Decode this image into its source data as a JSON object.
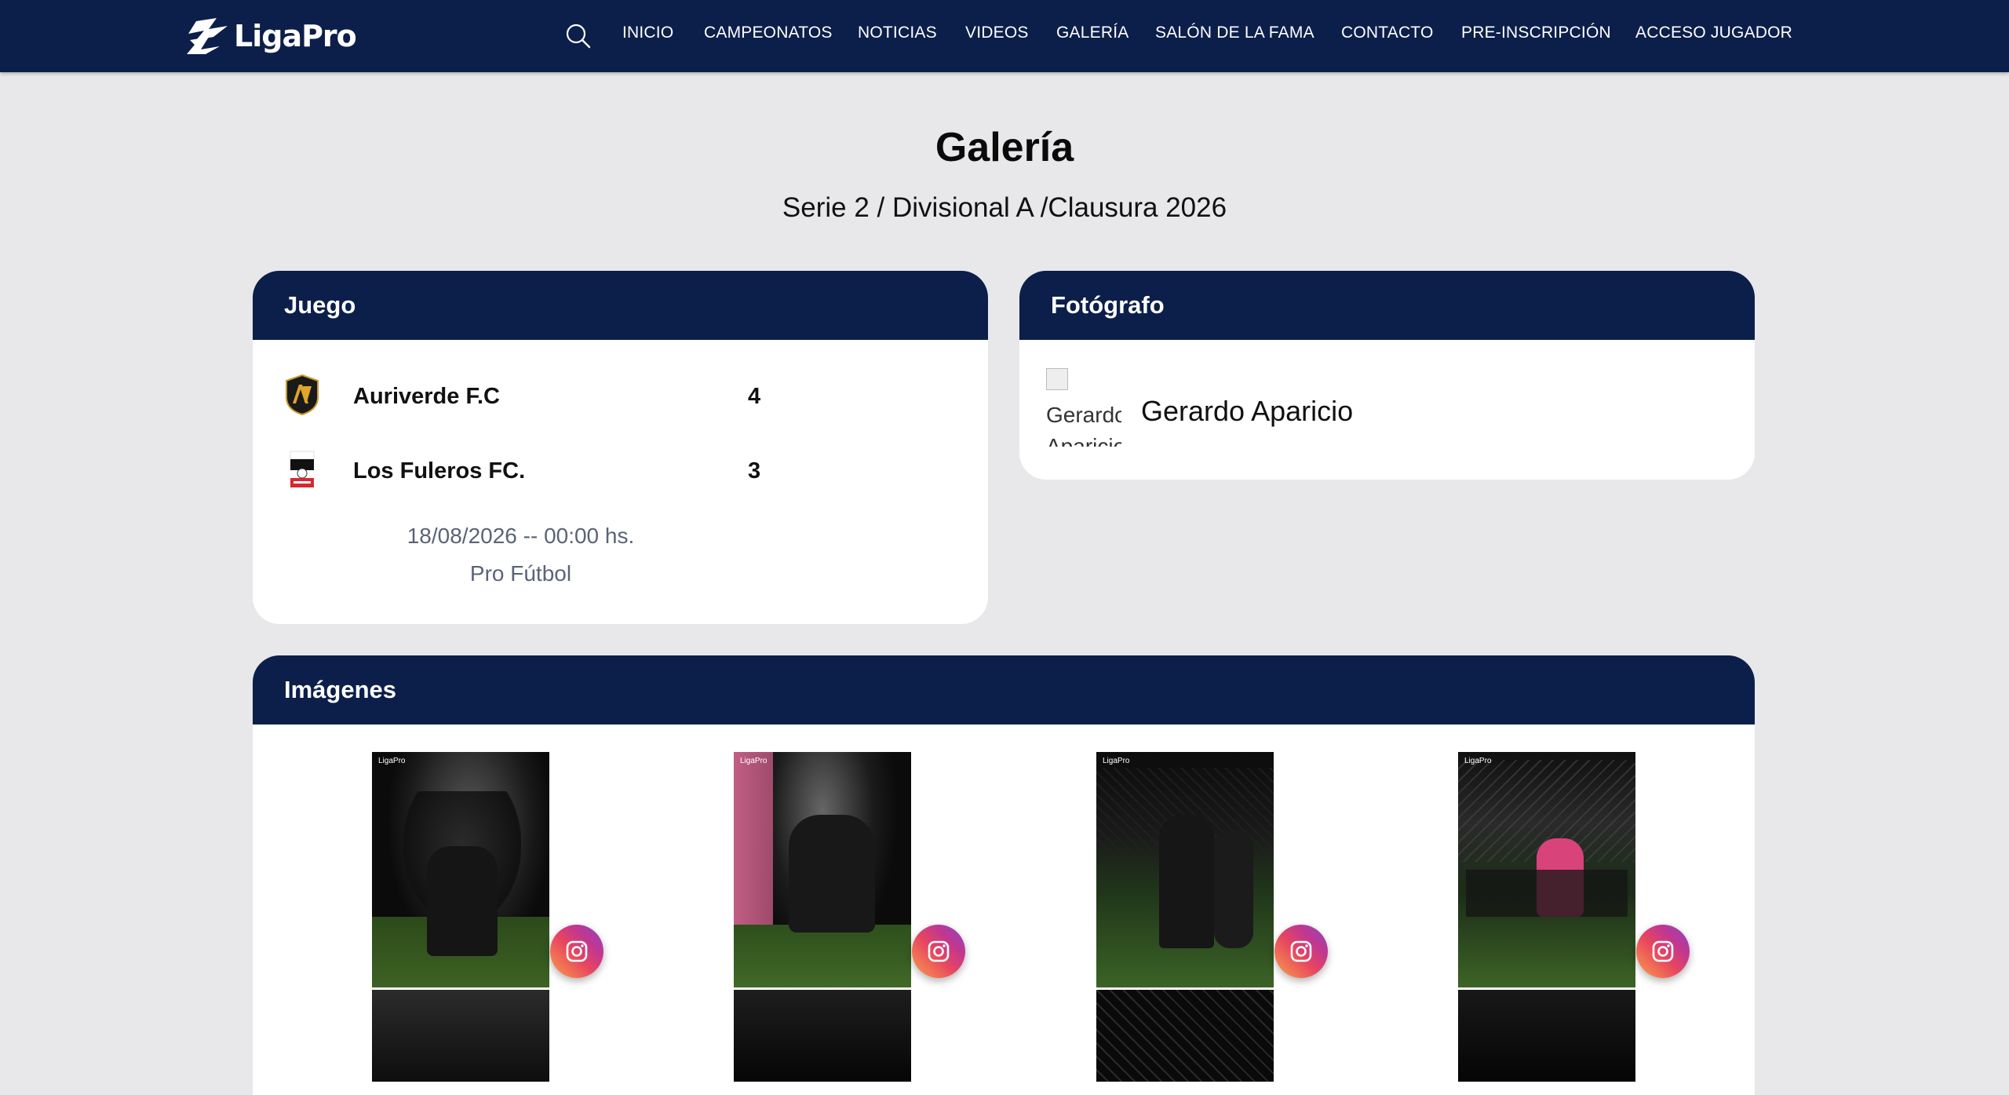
{
  "header": {
    "logo_text": "LigaPro",
    "nav": [
      "INICIO",
      "CAMPEONATOS",
      "NOTICIAS",
      "VIDEOS",
      "GALERÍA",
      "SALÓN DE LA FAMA",
      "CONTACTO",
      "PRE-INSCRIPCIÓN",
      "ACCESO JUGADOR"
    ]
  },
  "page": {
    "title": "Galería",
    "subtitle": "Serie 2 / Divisional A /Clausura 2026"
  },
  "game": {
    "heading": "Juego",
    "teams": [
      {
        "name": "Auriverde F.C",
        "score": "4",
        "logo_icon": "auriverde-crest-icon"
      },
      {
        "name": "Los Fuleros FC.",
        "score": "3",
        "logo_icon": "los-fuleros-crest-icon"
      }
    ],
    "datetime": "18/08/2026 -- 00:00 hs.",
    "organization": "Pro Fútbol"
  },
  "photographer": {
    "heading": "Fotógrafo",
    "image_alt": "Gerardo Aparicio",
    "name": "Gerardo Aparicio"
  },
  "images": {
    "heading": "Imágenes",
    "items": [
      {
        "share_icon": "instagram-icon",
        "watermark": "LigaPro"
      },
      {
        "share_icon": "instagram-icon",
        "watermark": "LigaPro"
      },
      {
        "share_icon": "instagram-icon",
        "watermark": "LigaPro"
      },
      {
        "share_icon": "instagram-icon",
        "watermark": "LigaPro"
      }
    ]
  },
  "colors": {
    "navy": "#0c1f4a",
    "background": "#e8e8eb",
    "muted_text": "#5b6378"
  }
}
